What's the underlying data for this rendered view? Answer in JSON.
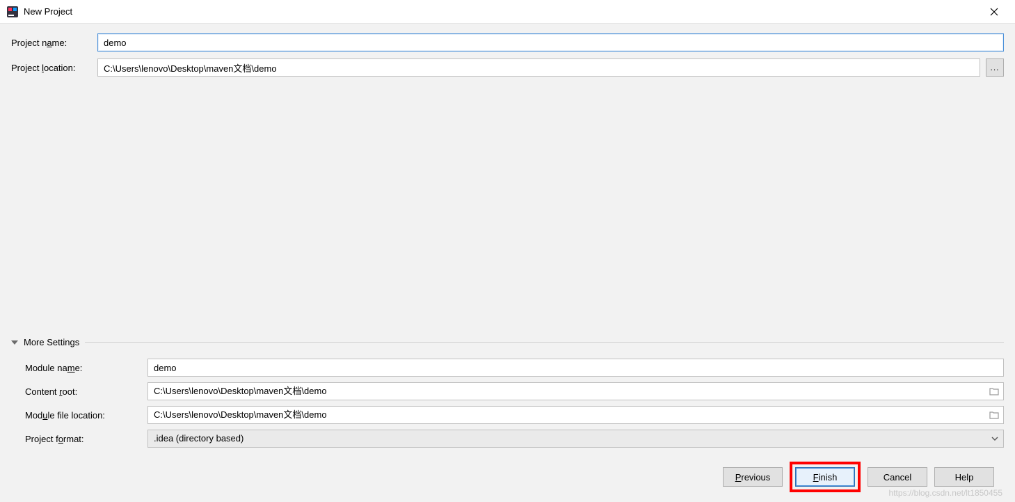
{
  "window": {
    "title": "New Project"
  },
  "form": {
    "project_name_label_pre": "Project n",
    "project_name_label_u": "a",
    "project_name_label_post": "me:",
    "project_name_value": "demo",
    "project_location_label_pre": "Project ",
    "project_location_label_u": "l",
    "project_location_label_post": "ocation:",
    "project_location_value": "C:\\Users\\lenovo\\Desktop\\maven文档\\demo",
    "browse_label": "..."
  },
  "more": {
    "title": "More Settings",
    "module_name_label_pre": "Module na",
    "module_name_label_u": "m",
    "module_name_label_post": "e:",
    "module_name_value": "demo",
    "content_root_label_pre": "Content ",
    "content_root_label_u": "r",
    "content_root_label_post": "oot:",
    "content_root_value": "C:\\Users\\lenovo\\Desktop\\maven文档\\demo",
    "module_file_loc_label_pre": "Mod",
    "module_file_loc_label_u": "u",
    "module_file_loc_label_post": "le file location:",
    "module_file_loc_value": "C:\\Users\\lenovo\\Desktop\\maven文档\\demo",
    "project_format_label_pre": "Project f",
    "project_format_label_u": "o",
    "project_format_label_post": "rmat:",
    "project_format_value": ".idea (directory based)"
  },
  "buttons": {
    "previous_u": "P",
    "previous_rest": "revious",
    "finish_u": "F",
    "finish_rest": "inish",
    "cancel": "Cancel",
    "help": "Help"
  },
  "watermark": "https://blog.csdn.net/lt1850455"
}
